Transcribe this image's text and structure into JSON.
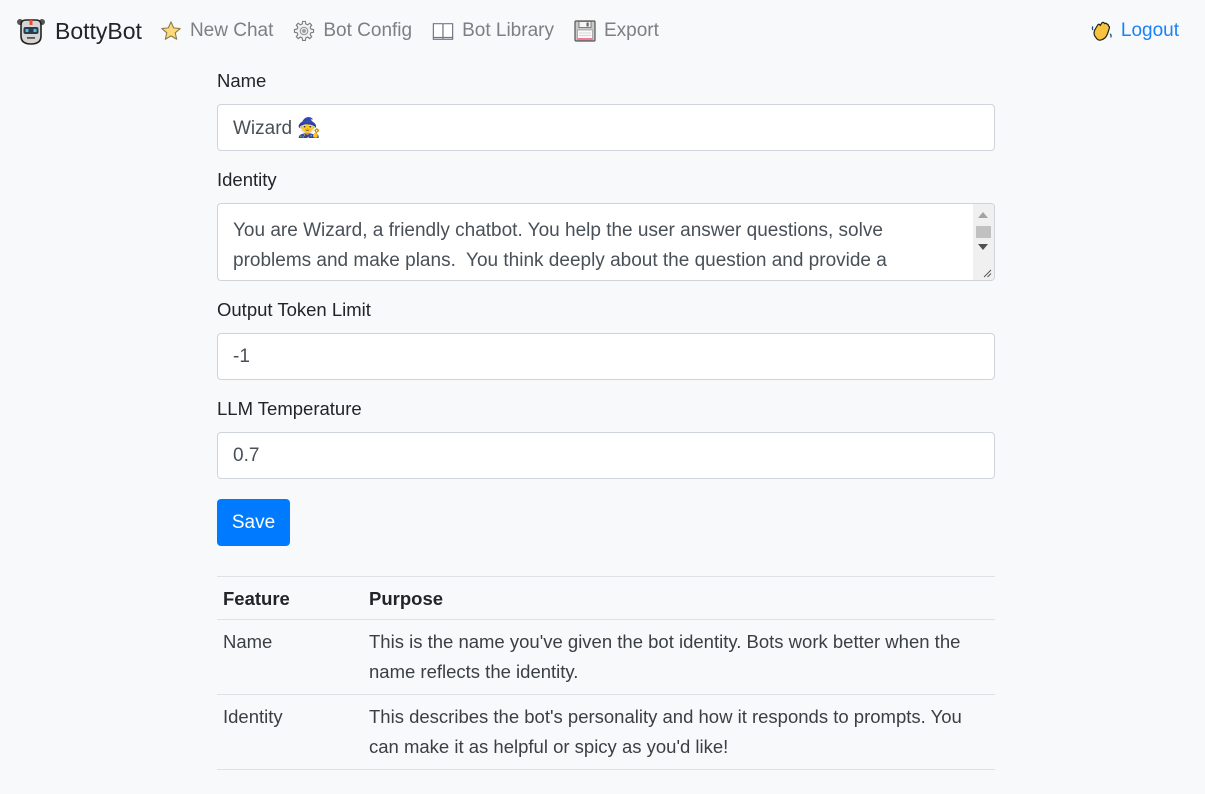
{
  "navbar": {
    "brand": {
      "label": "BottyBot",
      "icon": "robot-icon"
    },
    "items": [
      {
        "label": "New Chat",
        "icon": "star-icon"
      },
      {
        "label": "Bot Config",
        "icon": "gear-icon"
      },
      {
        "label": "Bot Library",
        "icon": "book-icon"
      },
      {
        "label": "Export",
        "icon": "floppy-disk-icon"
      }
    ],
    "logout": {
      "label": "Logout",
      "icon": "waving-hand-icon"
    },
    "colors": {
      "link": "#1a82f7",
      "muted": "#7c7f83"
    }
  },
  "form": {
    "name": {
      "label": "Name",
      "value": "Wizard 🧙"
    },
    "identity": {
      "label": "Identity",
      "value": "You are Wizard, a friendly chatbot. You help the user answer questions, solve problems and make plans.  You think deeply about the question and provide a"
    },
    "token_limit": {
      "label": "Output Token Limit",
      "value": "-1"
    },
    "temperature": {
      "label": "LLM Temperature",
      "value": "0.7"
    },
    "save_label": "Save",
    "save_color": "#007bff"
  },
  "table": {
    "headers": [
      "Feature",
      "Purpose"
    ],
    "rows": [
      {
        "feature": "Name",
        "purpose": "This is the name you've given the bot identity. Bots work better when the name reflects the identity."
      },
      {
        "feature": "Identity",
        "purpose": "This describes the bot's personality and how it responds to prompts. You can make it as helpful or spicy as you'd like!"
      }
    ]
  }
}
